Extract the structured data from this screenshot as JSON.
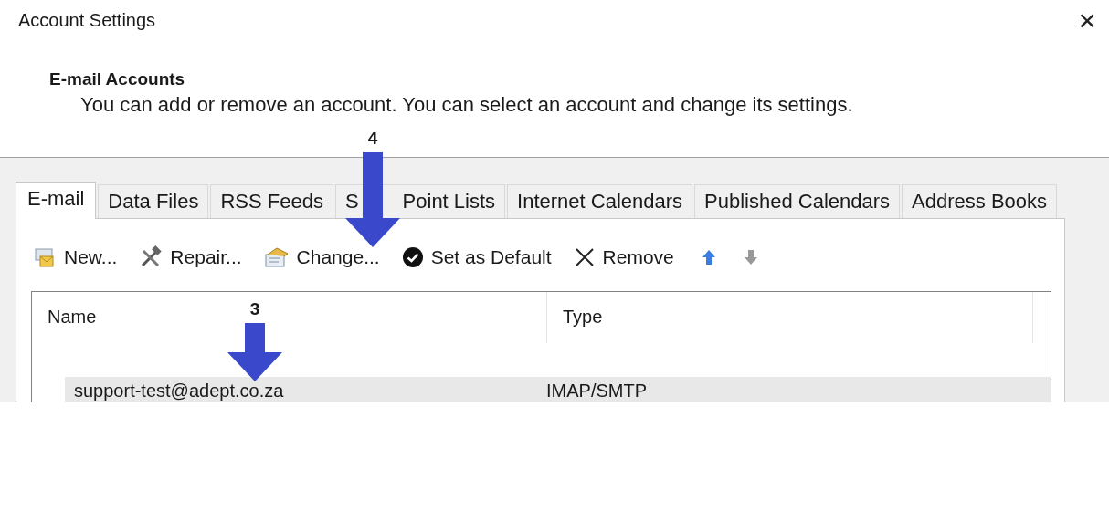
{
  "window": {
    "title": "Account Settings",
    "close": "×"
  },
  "section": {
    "heading": "E-mail Accounts",
    "description": "You can add or remove an account. You can select an account and change its settings."
  },
  "tabs": [
    {
      "label": "E-mail",
      "selected": true
    },
    {
      "label": "Data Files",
      "selected": false
    },
    {
      "label": "RSS Feeds",
      "selected": false
    },
    {
      "label": "S",
      "label_2": "Point Lists",
      "selected": false
    },
    {
      "label": "Internet Calendars",
      "selected": false
    },
    {
      "label": "Published Calendars",
      "selected": false
    },
    {
      "label": "Address Books",
      "selected": false
    }
  ],
  "toolbar": [
    {
      "kind": "new",
      "label": "New...",
      "disabled": false
    },
    {
      "kind": "repair",
      "label": "Repair...",
      "disabled": false
    },
    {
      "kind": "change",
      "label": "Change...",
      "disabled": false
    },
    {
      "kind": "default",
      "label": "Set as Default",
      "disabled": false
    },
    {
      "kind": "remove",
      "label": "Remove",
      "disabled": false
    },
    {
      "kind": "up",
      "disabled": false
    },
    {
      "kind": "down",
      "disabled": true
    }
  ],
  "list": {
    "columns": [
      "Name",
      "Type"
    ],
    "rows": [
      {
        "name": "support-test@adept.co.za",
        "type": "IMAP/SMTP",
        "selected": true
      }
    ]
  },
  "annotations": [
    {
      "label": "4"
    },
    {
      "label": "3"
    }
  ]
}
